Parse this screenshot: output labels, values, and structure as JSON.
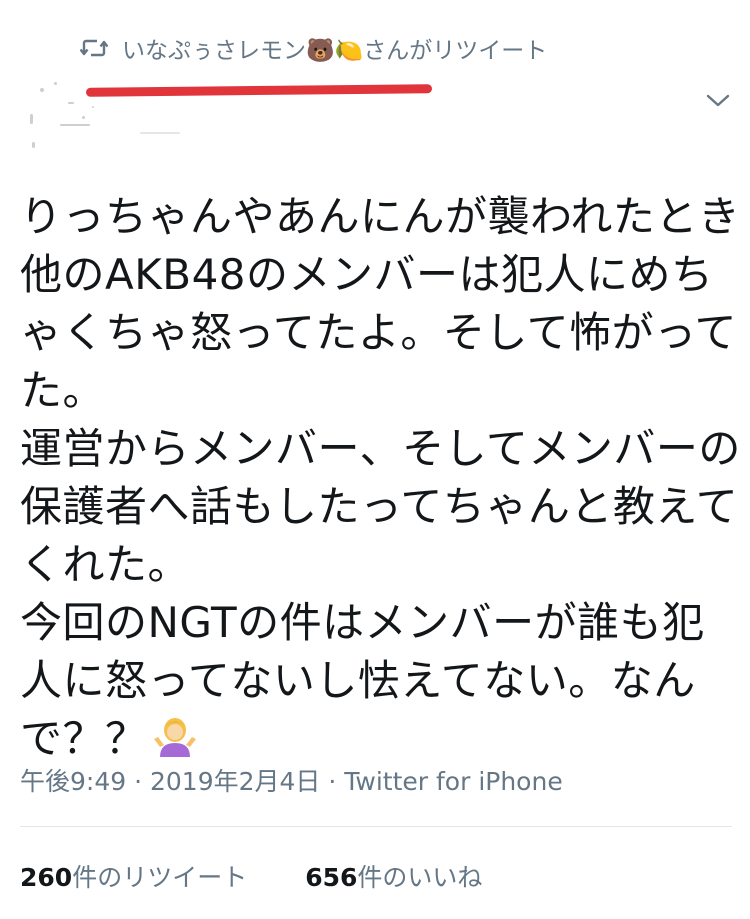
{
  "retweet_header": {
    "icon": "retweet-icon",
    "text": "いなぷぅさレモン🐻🍋さんがリツイート"
  },
  "tweet": {
    "lines": [
      "りっちゃんやあんにんが襲われたとき",
      "他のAKB48のメンバーは犯人にめち",
      "ゃくちゃ怒ってたよ。そして怖がって",
      "た。",
      "運営からメンバー、そしてメンバーの",
      "保護者へ話もしたってちゃんと教えて",
      "くれた。",
      "今回のNGTの件はメンバーが誰も犯",
      "人に怒ってないし怯えてない。なん",
      "で？？"
    ],
    "emoji": "person-shrugging-emoji"
  },
  "meta": {
    "text": "午後9:49 · 2019年2月4日 · Twitter for iPhone"
  },
  "stats": {
    "retweets_count": "260",
    "retweets_label": "件のリツイート",
    "likes_count": "656",
    "likes_label": "件のいいね"
  },
  "colors": {
    "secondary_text": "#657786",
    "primary_text": "#14171a",
    "annotation_red": "#e0353b",
    "divider": "#e1e8ed"
  }
}
